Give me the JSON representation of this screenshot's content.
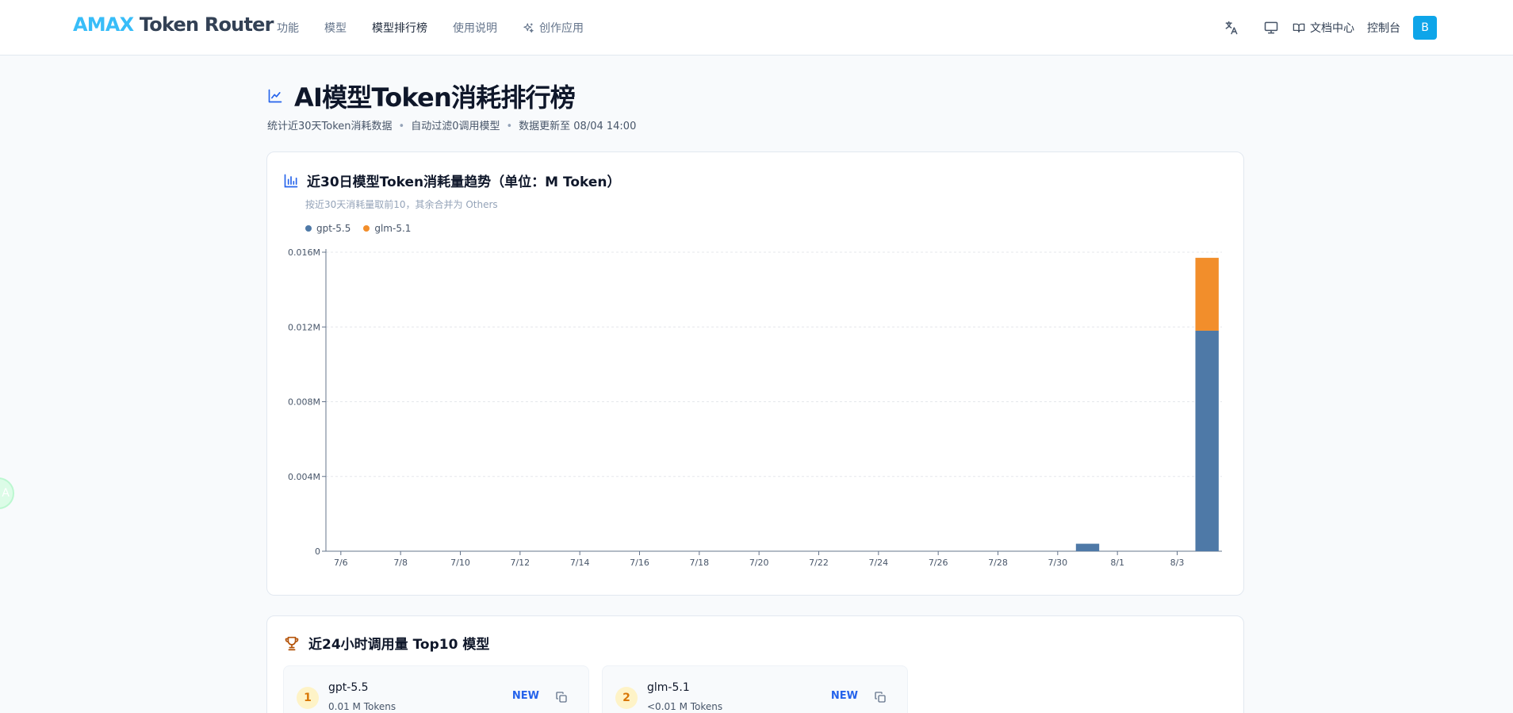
{
  "header": {
    "brand_part1": "AMAX",
    "brand_part2": "Token Router",
    "nav": [
      {
        "label": "功能"
      },
      {
        "label": "模型"
      },
      {
        "label": "模型排行榜"
      },
      {
        "label": "使用说明"
      },
      {
        "label": "创作应用"
      }
    ],
    "docs_label": "文档中心",
    "console_label": "控制台",
    "avatar_letter": "B"
  },
  "side_badge": "A",
  "page": {
    "title": "AI模型Token消耗排行榜",
    "subtitle_parts": [
      "统计近30天Token消耗数据",
      "自动过滤0调用模型",
      "数据更新至 08/04 14:00"
    ],
    "subtitle_sep": "•"
  },
  "trend_card": {
    "title": "近30日模型Token消耗量趋势（单位：M Token）",
    "note": "按近30天消耗量取前10，其余合并为 Others"
  },
  "colors": {
    "accent": "#2563eb",
    "gpt": "#4e79a7",
    "glm": "#f28e2b"
  },
  "chart_data": {
    "type": "bar",
    "stacked": true,
    "categories": [
      "7/6",
      "7/7",
      "7/8",
      "7/9",
      "7/10",
      "7/11",
      "7/12",
      "7/13",
      "7/14",
      "7/15",
      "7/16",
      "7/17",
      "7/18",
      "7/19",
      "7/20",
      "7/21",
      "7/22",
      "7/23",
      "7/24",
      "7/25",
      "7/26",
      "7/27",
      "7/28",
      "7/29",
      "7/30",
      "7/31",
      "8/1",
      "8/2",
      "8/3",
      "8/4"
    ],
    "x_tick_labels": [
      "7/6",
      "7/8",
      "7/10",
      "7/12",
      "7/14",
      "7/16",
      "7/18",
      "7/20",
      "7/22",
      "7/24",
      "7/26",
      "7/28",
      "7/30",
      "8/1",
      "8/3"
    ],
    "series": [
      {
        "name": "gpt-5.5",
        "color": "#4e79a7",
        "values": [
          0,
          0,
          0,
          0,
          0,
          0,
          0,
          0,
          0,
          0,
          0,
          0,
          0,
          0,
          0,
          0,
          0,
          0,
          0,
          0,
          0,
          0,
          0,
          0,
          0,
          0.0004,
          0,
          0,
          0,
          0.0118
        ]
      },
      {
        "name": "glm-5.1",
        "color": "#f28e2b",
        "values": [
          0,
          0,
          0,
          0,
          0,
          0,
          0,
          0,
          0,
          0,
          0,
          0,
          0,
          0,
          0,
          0,
          0,
          0,
          0,
          0,
          0,
          0,
          0,
          0,
          0,
          0,
          0,
          0,
          0,
          0.0039
        ]
      }
    ],
    "y_ticks": [
      "0",
      "0.004M",
      "0.008M",
      "0.012M",
      "0.016M"
    ],
    "y_tick_values": [
      0,
      0.004,
      0.008,
      0.012,
      0.016
    ],
    "ylim": [
      0,
      0.016
    ],
    "grid": true,
    "legend": "top-left"
  },
  "top_card": {
    "title": "近24小时调用量 Top10 模型",
    "items": [
      {
        "rank": "1",
        "name": "gpt-5.5",
        "tokens": "0.01 M Tokens",
        "badge": "NEW"
      },
      {
        "rank": "2",
        "name": "glm-5.1",
        "tokens": "<0.01 M Tokens",
        "badge": "NEW"
      }
    ]
  }
}
